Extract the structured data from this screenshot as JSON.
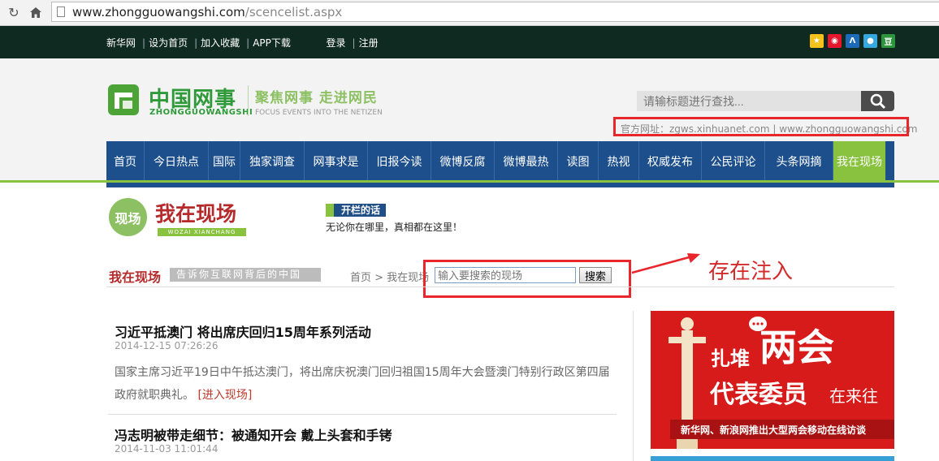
{
  "browser": {
    "url_host": "www.zhongguowangshi.com",
    "url_path": "/scencelist.aspx"
  },
  "topbar": {
    "links": [
      "新华网",
      "设为首页",
      "加入收藏",
      "APP下载"
    ],
    "auth": [
      "登录",
      "注册"
    ],
    "social_icons": [
      "qzone-icon",
      "weibo-icon",
      "renren-icon",
      "tqq-icon",
      "douban-icon"
    ],
    "douban_label": "豆"
  },
  "header": {
    "logo_name": "中国网事",
    "logo_pinyin": "ZHONGGUOWANGSHI",
    "slogan": "聚焦网事 走进网民",
    "slogan_en": "FOCUS EVENTS INTO THE NETIZEN",
    "search_placeholder": "请输标题进行查找...",
    "official_url": "官方网址：zgws.xinhuanet.com | www.zhongguowangshi.com"
  },
  "nav": {
    "items": [
      "首页",
      "今日热点",
      "国际",
      "独家调查",
      "网事求是",
      "旧报今读",
      "微博反腐",
      "微博最热",
      "读图",
      "热视",
      "权威发布",
      "公民评论",
      "头条网摘",
      "我在现场"
    ],
    "active": "我在现场"
  },
  "column": {
    "badge": "现场",
    "title": "我在现场",
    "title_en": "WOZAI XIANCHANG",
    "open_label": "开栏的话",
    "open_desc": "无论你在哪里，真相都在这里！",
    "bc_title": "我在现场",
    "bc_slogan": "告诉你互联网背后的中国",
    "breadcrumb": "首页 > 我在现场",
    "search_placeholder": "输入要搜索的现场",
    "search_button": "搜索",
    "annotation": "存在注入"
  },
  "articles": [
    {
      "title": "习近平抵澳门 将出席庆回归15周年系列活动",
      "date": "2014-12-15 07:26:26",
      "summary": "国家主席习近平19日中午抵达澳门，将出席庆祝澳门回归祖国15周年大会暨澳门特别行政区第四届政府就职典礼。",
      "link": "[进入现场]"
    },
    {
      "title": "冯志明被带走细节：被通知开会 戴上头套和手铐",
      "date": "2014-11-03 11:01:44"
    }
  ],
  "ad": {
    "line1": "扎堆",
    "line2": "两会",
    "line3": "代表委员",
    "line4": "在来往",
    "footer": "新华网、新浪网推出大型两会移动在线访谈"
  },
  "colors": {
    "nav_blue": "#1d4f8c",
    "brand_green": "#88c23e",
    "title_red": "#b52a2b",
    "annotation_red": "#e8262b"
  }
}
